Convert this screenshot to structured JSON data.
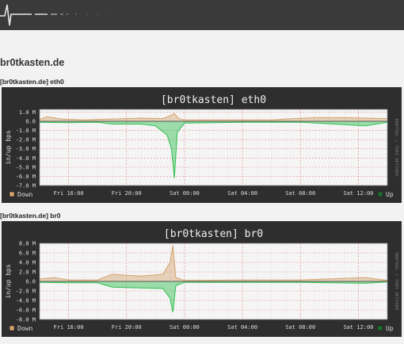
{
  "site": {
    "logo": "heartbeat-logo",
    "host_title": "br0tkasten.de"
  },
  "graphs": [
    {
      "section_label": "[br0tkasten.de] eth0",
      "chart_data": {
        "type": "area",
        "title": "[br0tkasten] eth0",
        "ylabel": "in/up bps",
        "watermark": "RRDTOOL / TOBI OETIKER",
        "ylim": [
          -7000000,
          1300000
        ],
        "yticks": [
          1000000,
          0,
          -1000000,
          -2000000,
          -3000000,
          -4000000,
          -5000000,
          -6000000,
          -7000000
        ],
        "ytick_labels": [
          "1.0 M",
          "0.0",
          "-1.0 M",
          "-2.0 M",
          "-3.0 M",
          "-4.0 M",
          "-5.0 M",
          "-6.0 M",
          "-7.0 M"
        ],
        "xlim": [
          0,
          24
        ],
        "xticks": [
          2,
          6,
          10,
          14,
          18,
          22
        ],
        "xtick_labels": [
          "Fri 16:00",
          "Fri 20:00",
          "Sat 00:00",
          "Sat 04:00",
          "Sat 08:00",
          "Sat 12:00"
        ],
        "legend": [
          "Down",
          "Up"
        ],
        "series": [
          {
            "name": "Down",
            "color": "#d5a36e",
            "points": [
              [
                0,
                200000
              ],
              [
                0.5,
                500000
              ],
              [
                1.5,
                250000
              ],
              [
                3,
                150000
              ],
              [
                5,
                250000
              ],
              [
                7,
                350000
              ],
              [
                8.5,
                300000
              ],
              [
                9,
                600000
              ],
              [
                9.3,
                850000
              ],
              [
                9.6,
                300000
              ],
              [
                10,
                150000
              ],
              [
                12,
                150000
              ],
              [
                16,
                150000
              ],
              [
                17.5,
                300000
              ],
              [
                19,
                400000
              ],
              [
                21,
                400000
              ],
              [
                22.5,
                350000
              ],
              [
                24,
                300000
              ]
            ]
          },
          {
            "name": "Up",
            "color": "#2fbf4f",
            "points": [
              [
                0,
                -100000
              ],
              [
                2,
                -150000
              ],
              [
                4,
                -100000
              ],
              [
                5,
                -300000
              ],
              [
                7,
                -300000
              ],
              [
                8,
                -500000
              ],
              [
                8.8,
                -1500000
              ],
              [
                9.1,
                -3000000
              ],
              [
                9.3,
                -6200000
              ],
              [
                9.5,
                -1200000
              ],
              [
                10,
                -200000
              ],
              [
                14,
                -100000
              ],
              [
                18,
                -100000
              ],
              [
                22.5,
                -500000
              ],
              [
                24,
                -100000
              ]
            ]
          }
        ]
      }
    },
    {
      "section_label": "[br0tkasten.de] br0",
      "chart_data": {
        "type": "area",
        "title": "[br0tkasten] br0",
        "ylabel": "in/up bps",
        "watermark": "RRDTOOL / TOBI OETIKER",
        "ylim": [
          -8000000,
          8000000
        ],
        "yticks": [
          8000000,
          6000000,
          4000000,
          2000000,
          0,
          -2000000,
          -4000000,
          -6000000,
          -8000000
        ],
        "ytick_labels": [
          "8.0 M",
          "6.0 M",
          "4.0 M",
          "2.0 M",
          "0.0",
          "-2.0 M",
          "-4.0 M",
          "-6.0 M",
          "-8.0 M"
        ],
        "xlim": [
          0,
          24
        ],
        "xticks": [
          2,
          6,
          10,
          14,
          18,
          22
        ],
        "xtick_labels": [
          "Fri 16:00",
          "Fri 20:00",
          "Sat 00:00",
          "Sat 04:00",
          "Sat 08:00",
          "Sat 12:00"
        ],
        "legend": [
          "Down",
          "Up"
        ],
        "series": [
          {
            "name": "Down",
            "color": "#d5a36e",
            "points": [
              [
                0,
                500000
              ],
              [
                1,
                800000
              ],
              [
                2,
                300000
              ],
              [
                4,
                300000
              ],
              [
                5,
                1500000
              ],
              [
                6,
                1300000
              ],
              [
                7,
                1100000
              ],
              [
                8.5,
                1500000
              ],
              [
                9,
                4000000
              ],
              [
                9.2,
                7600000
              ],
              [
                9.4,
                800000
              ],
              [
                10,
                200000
              ],
              [
                14,
                300000
              ],
              [
                18,
                300000
              ],
              [
                22.5,
                800000
              ],
              [
                24,
                200000
              ]
            ]
          },
          {
            "name": "Up",
            "color": "#2fbf4f",
            "points": [
              [
                0,
                -200000
              ],
              [
                2,
                -300000
              ],
              [
                4,
                -300000
              ],
              [
                5,
                -1200000
              ],
              [
                6,
                -1300000
              ],
              [
                8.5,
                -1500000
              ],
              [
                9,
                -3500000
              ],
              [
                9.2,
                -6500000
              ],
              [
                9.4,
                -900000
              ],
              [
                10,
                -200000
              ],
              [
                14,
                -200000
              ],
              [
                18,
                -200000
              ],
              [
                22.5,
                -400000
              ],
              [
                24,
                -100000
              ]
            ]
          }
        ]
      }
    }
  ]
}
